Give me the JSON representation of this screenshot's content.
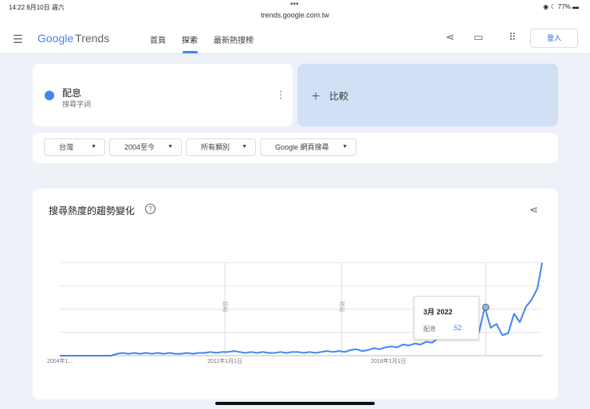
{
  "status_bar": {
    "time": "14:22  8月10日 週六",
    "url": "trends.google.com.tw",
    "battery": "77%"
  },
  "header": {
    "logo_google": "Google",
    "logo_trends": "Trends",
    "nav": [
      "首頁",
      "探索",
      "最新熱搜榜"
    ],
    "active_nav": 1,
    "login": "登入"
  },
  "search": {
    "term": "配息",
    "term_type": "搜尋字詞",
    "compare": "比較",
    "term_color": "#4285f4"
  },
  "filters": [
    "台灣",
    "2004至今",
    "所有類別",
    "Google 網頁搜尋"
  ],
  "chart_card": {
    "title": "搜尋熱度的趨勢變化"
  },
  "tooltip": {
    "date": "3月 2022",
    "term": "配息",
    "value": "52"
  },
  "chart_data": {
    "type": "line",
    "title": "搜尋熱度的趨勢變化",
    "x_start": "2004-01",
    "x_step": "quarter",
    "x_end": "2024-08",
    "xtick_labels": [
      "2004年1...",
      "2011年1月1日",
      "2018年1月1日"
    ],
    "ylim": [
      0,
      100
    ],
    "yticks": [
      0,
      25,
      50,
      75,
      100
    ],
    "grid": true,
    "annotations": [
      {
        "date": "2011-01",
        "label": "附註"
      },
      {
        "date": "2016-01",
        "label": "附註"
      },
      {
        "date": "2022-03",
        "label": ""
      }
    ],
    "series": [
      {
        "name": "配息",
        "color": "#4285f4",
        "values": [
          0,
          0,
          0,
          0,
          0,
          0,
          0,
          0,
          0,
          2,
          3,
          2,
          3,
          2,
          3,
          2,
          3,
          2,
          3,
          2,
          2,
          3,
          2,
          3,
          3,
          4,
          3,
          4,
          4,
          5,
          4,
          3,
          4,
          3,
          4,
          3,
          3,
          4,
          3,
          4,
          4,
          3,
          4,
          3,
          4,
          5,
          4,
          5,
          4,
          6,
          7,
          5,
          6,
          8,
          7,
          9,
          10,
          9,
          12,
          11,
          13,
          12,
          15,
          14,
          19,
          23,
          29,
          27,
          33,
          30,
          38,
          25,
          52,
          30,
          34,
          22,
          24,
          45,
          36,
          52,
          60,
          72,
          100
        ]
      }
    ]
  }
}
